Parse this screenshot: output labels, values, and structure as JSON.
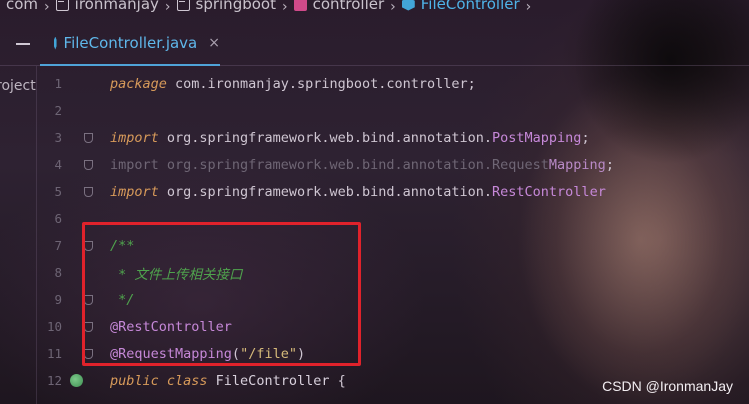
{
  "breadcrumb": [
    {
      "label": "com",
      "icon": "folder-icon"
    },
    {
      "label": "ironmanjay",
      "icon": "folder-icon"
    },
    {
      "label": "springboot",
      "icon": "folder-icon"
    },
    {
      "label": "controller",
      "icon": "package-icon"
    },
    {
      "label": "FileController",
      "icon": "java-class-icon"
    }
  ],
  "tab": {
    "label": "FileController.java",
    "close": "×"
  },
  "sidebar": {
    "project_label": "roject"
  },
  "editor": {
    "lines": [
      {
        "n": "1",
        "parts": [
          [
            "kw",
            "package"
          ],
          [
            "pk",
            " com.ironmanjay.springboot.controller;"
          ]
        ]
      },
      {
        "n": "2",
        "parts": []
      },
      {
        "n": "3",
        "parts": [
          [
            "kw",
            "import"
          ],
          [
            "pk",
            " org.springframework.web.bind.annotation."
          ],
          [
            "ann",
            "PostMapping"
          ],
          [
            "pk",
            ";"
          ]
        ]
      },
      {
        "n": "4",
        "parts": [
          [
            "dim",
            "import org.springframework.web.bind.annotation.Request"
          ],
          [
            "dim-ann",
            "Mapping"
          ],
          [
            "pk",
            ";"
          ]
        ]
      },
      {
        "n": "5",
        "parts": [
          [
            "kw",
            "import"
          ],
          [
            "pk",
            " org.springframework.web.bind.annotation."
          ],
          [
            "ann",
            "RestController"
          ]
        ]
      },
      {
        "n": "6",
        "parts": []
      },
      {
        "n": "7",
        "parts": [
          [
            "cmt",
            "/**"
          ]
        ]
      },
      {
        "n": "8",
        "parts": [
          [
            "cmt",
            " * 文件上传相关接口"
          ]
        ]
      },
      {
        "n": "9",
        "parts": [
          [
            "cmt",
            " */"
          ]
        ]
      },
      {
        "n": "10",
        "parts": [
          [
            "ann",
            "@RestController"
          ]
        ]
      },
      {
        "n": "11",
        "parts": [
          [
            "ann",
            "@RequestMapping"
          ],
          [
            "pk",
            "("
          ],
          [
            "str",
            "\"/file\""
          ],
          [
            "pk",
            ")"
          ]
        ]
      },
      {
        "n": "12",
        "parts": [
          [
            "kw",
            "public class"
          ],
          [
            "cls",
            " FileController "
          ],
          [
            "pk",
            "{"
          ]
        ]
      }
    ]
  },
  "watermark": "CSDN @IronmanJay"
}
